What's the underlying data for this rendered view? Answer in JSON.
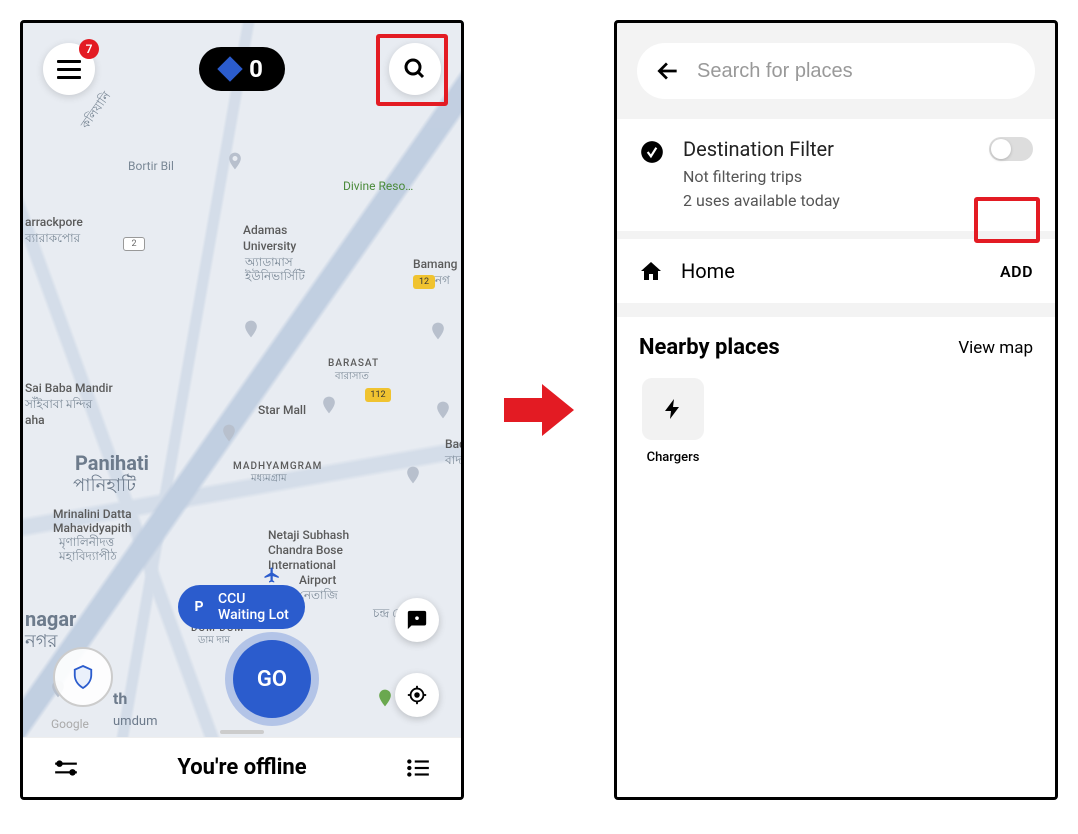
{
  "left": {
    "menu_badge": "7",
    "points_count": "0",
    "ccu_p": "P",
    "ccu_line1": "CCU",
    "ccu_line2": "Waiting Lot",
    "go_label": "GO",
    "status_text": "You're offline",
    "map_labels": {
      "bortir": "Bortir Bil",
      "divine": "Divine Reso…",
      "rackpore1": "arrackpore",
      "rackpore2": "ব্যারাকপোর",
      "adamas1": "Adamas",
      "adamas2": "University",
      "adamas3": "অ্যাডামাস",
      "adamas4": "ইউনিভার্সিটি",
      "bamang1": "Bamang",
      "bamang2": "বামনগ",
      "saibaba1": "Sai Baba Mandir",
      "saibaba2": "সাঁইবাবা মন্দির",
      "aha": "aha",
      "starmall": "Star Mall",
      "barasat1": "BARASAT",
      "barasat2": "বারাসাত",
      "panihati1": "Panihati",
      "panihati2": "পানিহাটি",
      "madhyamgram1": "MADHYAMGRAM",
      "madhyamgram2": "মধ্যমগ্রাম",
      "bad1": "Bad",
      "bad2": "বাদ",
      "mrinalini1": "Mrinalini Datta",
      "mrinalini2": "Mahavidyapith",
      "mrinalini3": "মৃণালিনীদত্ত",
      "mrinalini4": "মহাবিদ্যাপীঠ",
      "airport1": "Netaji Subhash",
      "airport2": "Chandra Bose",
      "airport3": "International",
      "airport4": "Airport",
      "airport5": "নেতাজি",
      "airport6": "চন্দ্ৰ বোস",
      "dumdum1": "DUM DUM",
      "dumdum2": "ডাম দাম",
      "nagar1": "nagar",
      "nagar2": "নগর",
      "south1": "th",
      "south2": "umdum",
      "google": "Google",
      "kalyani": "কলিযানি"
    }
  },
  "right": {
    "search_placeholder": "Search for places",
    "filter_title": "Destination Filter",
    "filter_sub1": "Not filtering trips",
    "filter_sub2": "2 uses available today",
    "home_label": "Home",
    "add_label": "ADD",
    "nearby_title": "Nearby places",
    "view_map": "View map",
    "chargers_label": "Chargers"
  }
}
